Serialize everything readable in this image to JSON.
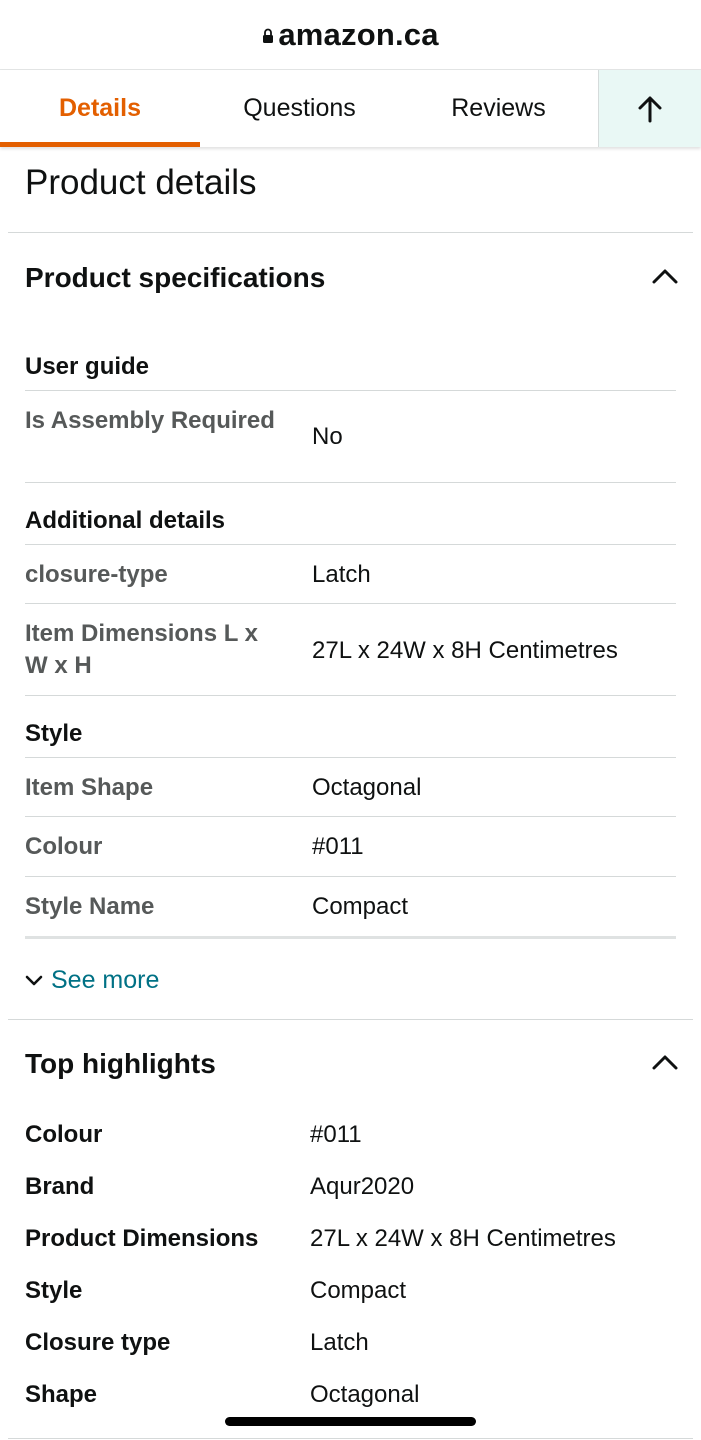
{
  "browser": {
    "host": "amazon.ca",
    "lock_icon": "lock-icon"
  },
  "tabs": [
    {
      "label": "Details",
      "active": true
    },
    {
      "label": "Questions",
      "active": false
    },
    {
      "label": "Reviews",
      "active": false
    }
  ],
  "scroll_top_icon": "arrow-up-icon",
  "page_title": "Product details",
  "specifications": {
    "title": "Product specifications",
    "expanded": true,
    "groups": [
      {
        "heading": "User guide",
        "rows": [
          {
            "label": "Is Assembly Required",
            "value": "No"
          }
        ]
      },
      {
        "heading": "Additional details",
        "rows": [
          {
            "label": "closure-type",
            "value": "Latch"
          },
          {
            "label": "Item Dimensions L x W x H",
            "value": "27L x 24W x 8H Centimetres"
          }
        ]
      },
      {
        "heading": "Style",
        "rows": [
          {
            "label": "Item Shape",
            "value": "Octagonal"
          },
          {
            "label": "Colour",
            "value": "#011"
          },
          {
            "label": "Style Name",
            "value": "Compact"
          }
        ]
      }
    ],
    "see_more_label": "See more"
  },
  "highlights": {
    "title": "Top highlights",
    "expanded": true,
    "rows": [
      {
        "label": "Colour",
        "value": "#011"
      },
      {
        "label": "Brand",
        "value": "Aqur2020"
      },
      {
        "label": "Product Dimensions",
        "value": "27L x 24W x 8H Centimetres"
      },
      {
        "label": "Style",
        "value": "Compact"
      },
      {
        "label": "Closure type",
        "value": "Latch"
      },
      {
        "label": "Shape",
        "value": "Octagonal"
      }
    ]
  },
  "colors": {
    "accent": "#e35f00",
    "link": "#007185",
    "muted_label": "#565959",
    "up_button_bg": "#e9f8f5"
  }
}
